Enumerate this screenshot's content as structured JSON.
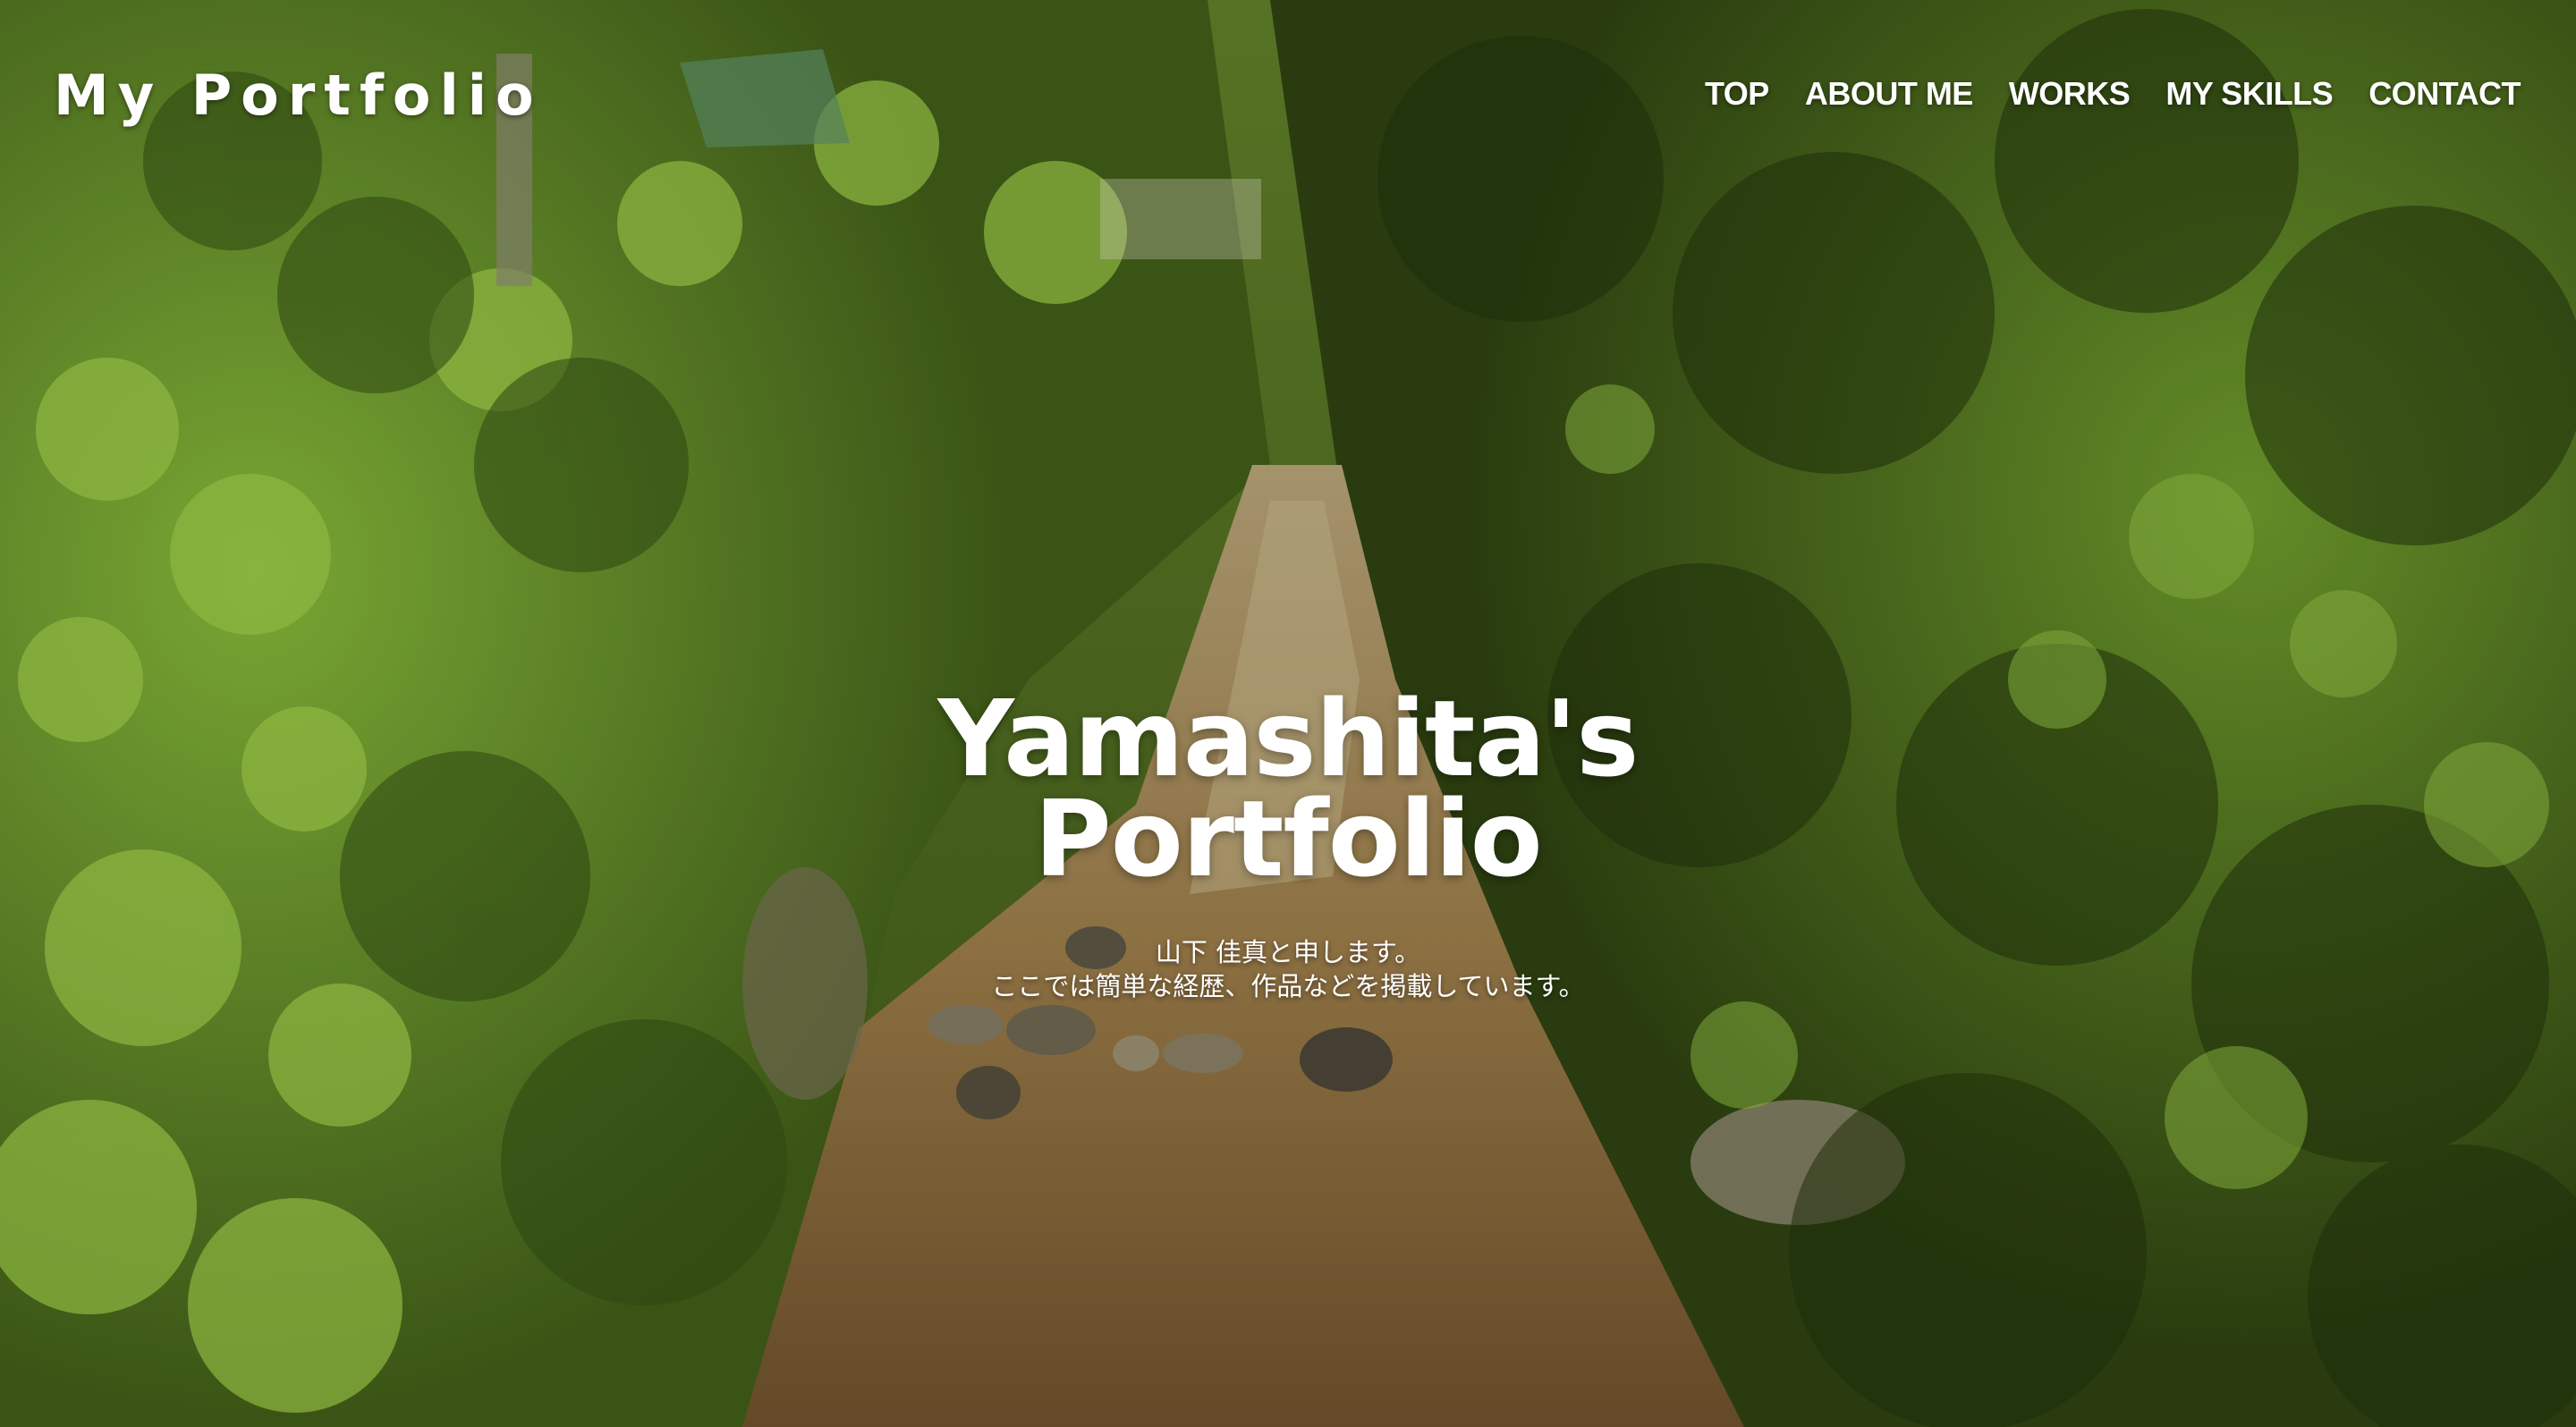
{
  "header": {
    "logo": "My Portfolio",
    "nav": [
      "TOP",
      "ABOUT ME",
      "WORKS",
      "MY SKILLS",
      "CONTACT"
    ]
  },
  "hero": {
    "title_line1": "Yamashita's",
    "title_line2": "Portfolio",
    "sub_line1": "山下 佳真と申します。",
    "sub_line2": "ここでは簡単な経歴、作品などを掲載しています。",
    "background": "forest stream photo"
  },
  "colors": {
    "text": "#ffffff",
    "foliage_dark": "#2f4513",
    "foliage_light": "#7ea936",
    "stream_bed": "#8a6a3e"
  }
}
